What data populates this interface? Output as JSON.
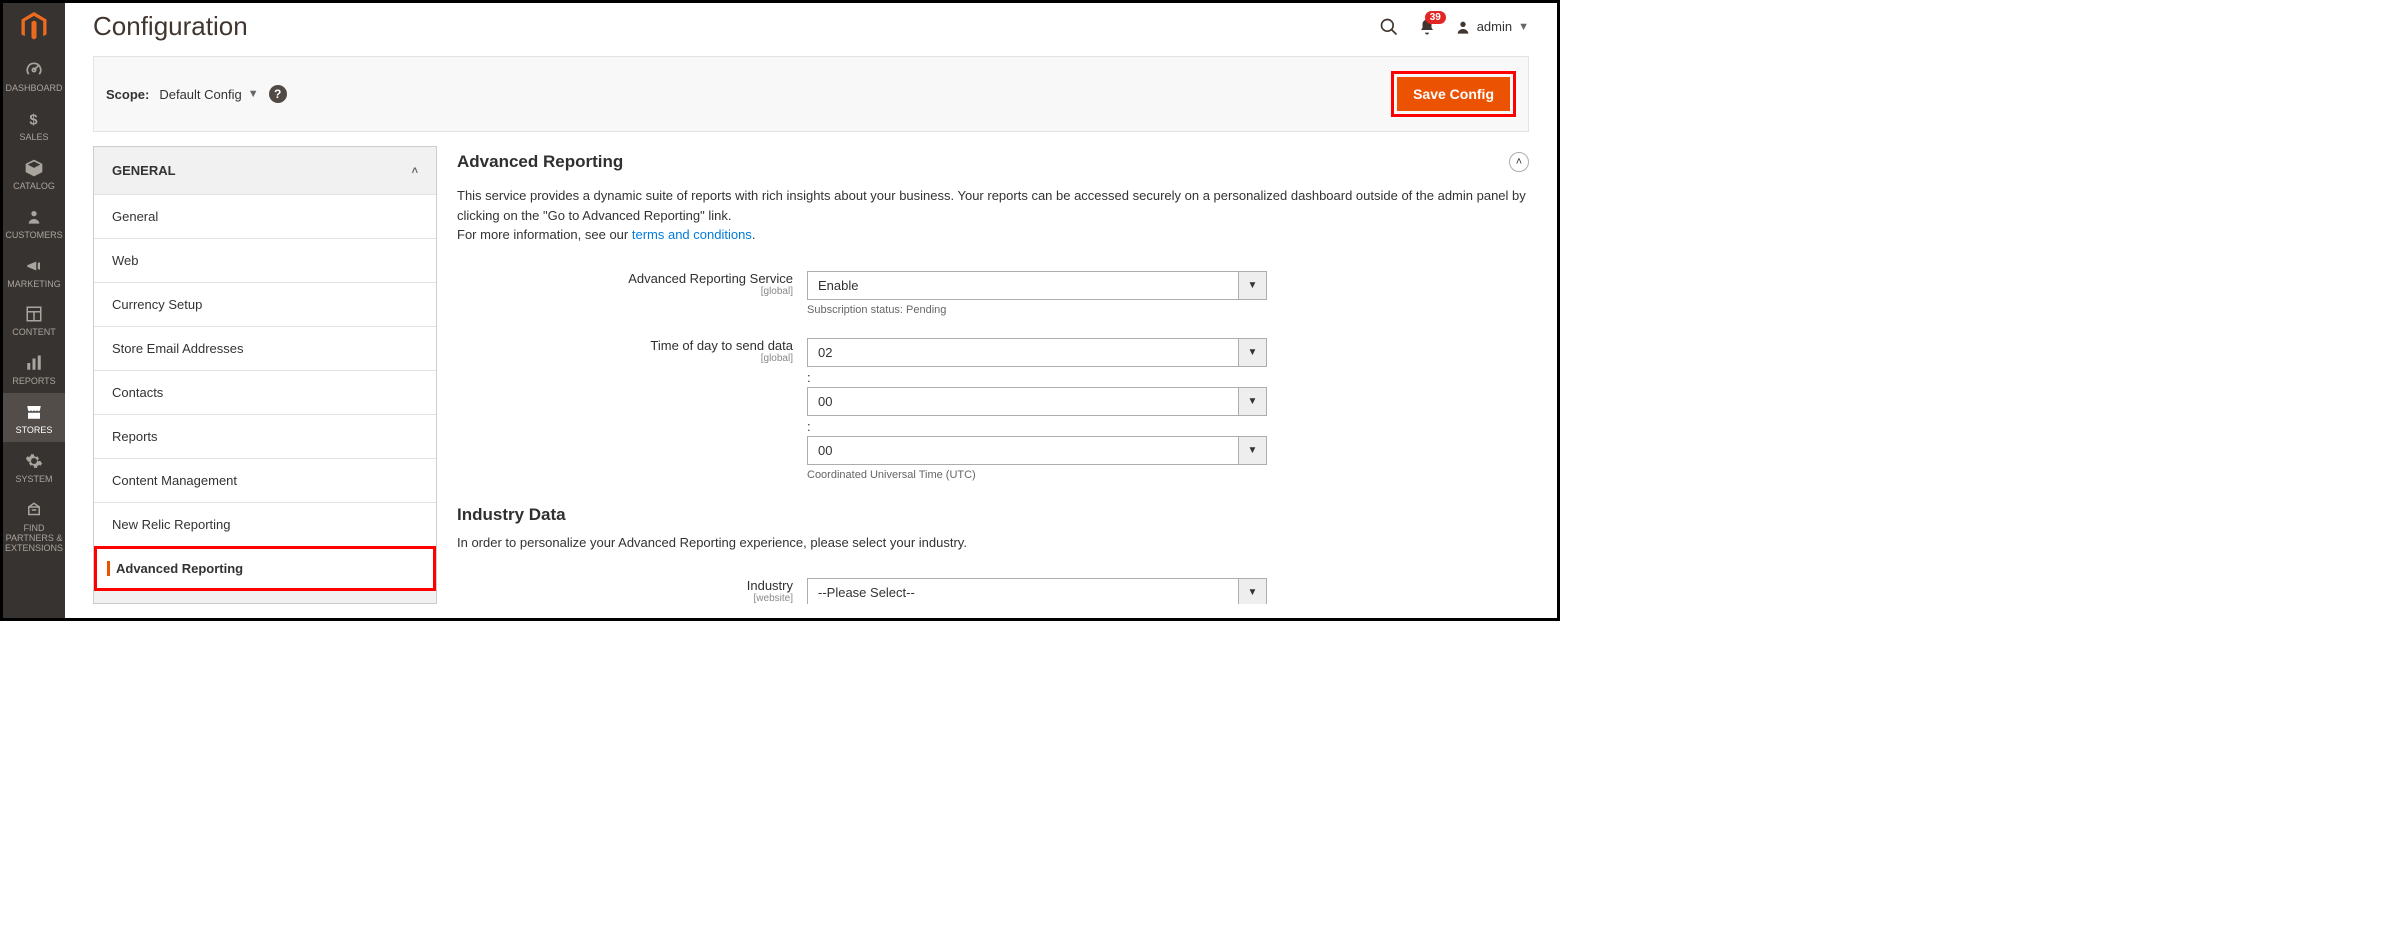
{
  "header": {
    "title": "Configuration",
    "notification_count": "39",
    "admin_label": "admin"
  },
  "scope": {
    "label": "Scope:",
    "value": "Default Config"
  },
  "actions": {
    "save_label": "Save Config"
  },
  "config_nav": {
    "group_label": "GENERAL",
    "items": {
      "general": "General",
      "web": "Web",
      "currency": "Currency Setup",
      "store_email": "Store Email Addresses",
      "contacts": "Contacts",
      "reports": "Reports",
      "content_mgmt": "Content Management",
      "new_relic": "New Relic Reporting",
      "adv_reporting": "Advanced Reporting"
    }
  },
  "panel": {
    "section_title": "Advanced Reporting",
    "desc_line1": "This service provides a dynamic suite of reports with rich insights about your business. Your reports can be accessed securely on a personalized dashboard outside of the admin panel by clicking on the \"Go to Advanced Reporting\" link.",
    "desc_line2_prefix": "For more information, see our ",
    "desc_link": "terms and conditions",
    "desc_line2_suffix": ".",
    "fields": {
      "service_label": "Advanced Reporting Service",
      "service_scope": "[global]",
      "service_value": "Enable",
      "service_note": "Subscription status: Pending",
      "time_label": "Time of day to send data",
      "time_scope": "[global]",
      "time_hour": "02",
      "time_min": "00",
      "time_sec": "00",
      "time_note": "Coordinated Universal Time (UTC)",
      "industry_section": "Industry Data",
      "industry_desc": "In order to personalize your Advanced Reporting experience, please select your industry.",
      "industry_label": "Industry",
      "industry_scope": "[website]",
      "industry_value": "--Please Select--"
    }
  },
  "sidebar": {
    "dashboard": "DASHBOARD",
    "sales": "SALES",
    "catalog": "CATALOG",
    "customers": "CUSTOMERS",
    "marketing": "MARKETING",
    "content": "CONTENT",
    "reports": "REPORTS",
    "stores": "STORES",
    "system": "SYSTEM",
    "partners": "FIND PARTNERS & EXTENSIONS"
  }
}
